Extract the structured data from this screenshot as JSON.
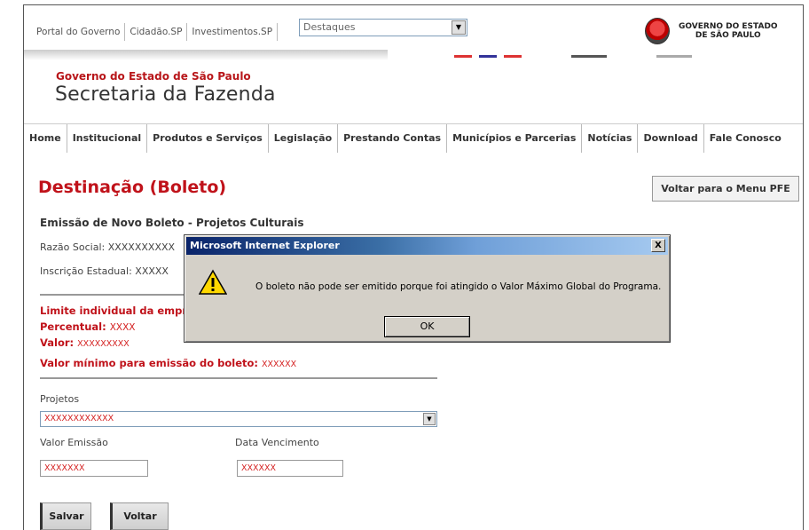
{
  "portal": {
    "links": [
      "Portal do Governo",
      "Cidadão.SP",
      "Investimentos.SP"
    ],
    "select_value": "Destaques",
    "gov_logo_line1": "GOVERNO DO ESTADO",
    "gov_logo_line2": "DE SÃO PAULO"
  },
  "header": {
    "gov_name": "Governo do Estado de São Paulo",
    "title": "Secretaria da Fazenda"
  },
  "nav": {
    "items": [
      "Home",
      "Institucional",
      "Produtos e Serviços",
      "Legislação",
      "Prestando Contas",
      "Municípios e Parcerias",
      "Notícias",
      "Download",
      "Fale Conosco"
    ]
  },
  "page": {
    "title": "Destinação (Boleto)",
    "back_button": "Voltar para o Menu PFE",
    "subtitle": "Emissão de Novo Boleto - Projetos Culturais",
    "razao_social_label": "Razão Social:",
    "razao_social_value": "XXXXXXXXXX",
    "inscricao_label": "Inscrição Estadual:",
    "inscricao_value": "XXXXX",
    "limite_label": "Limite individual da empre",
    "percentual_label": "Percentual:",
    "percentual_value": "XXXX",
    "valor_label": "Valor:",
    "valor_value": "XXXXXXXXX",
    "valor_minimo_label": "Valor mínimo para emissão do boleto:",
    "valor_minimo_value": "XXXXXX"
  },
  "form": {
    "projetos_label": "Projetos",
    "projetos_value": "XXXXXXXXXXXX",
    "valor_emissao_label": "Valor Emissão",
    "valor_emissao_value": "XXXXXXX",
    "data_vencimento_label": "Data Vencimento",
    "data_vencimento_value": "XXXXXX",
    "save_button": "Salvar",
    "back_button": "Voltar"
  },
  "dialog": {
    "title": "Microsoft Internet Explorer",
    "close": "X",
    "message": "O boleto não pode ser emitido porque foi atingido o Valor Máximo Global do Programa.",
    "ok_button": "OK"
  },
  "colors": {
    "accent_red": "#c0121a",
    "dialog_title_start": "#0a246a"
  }
}
